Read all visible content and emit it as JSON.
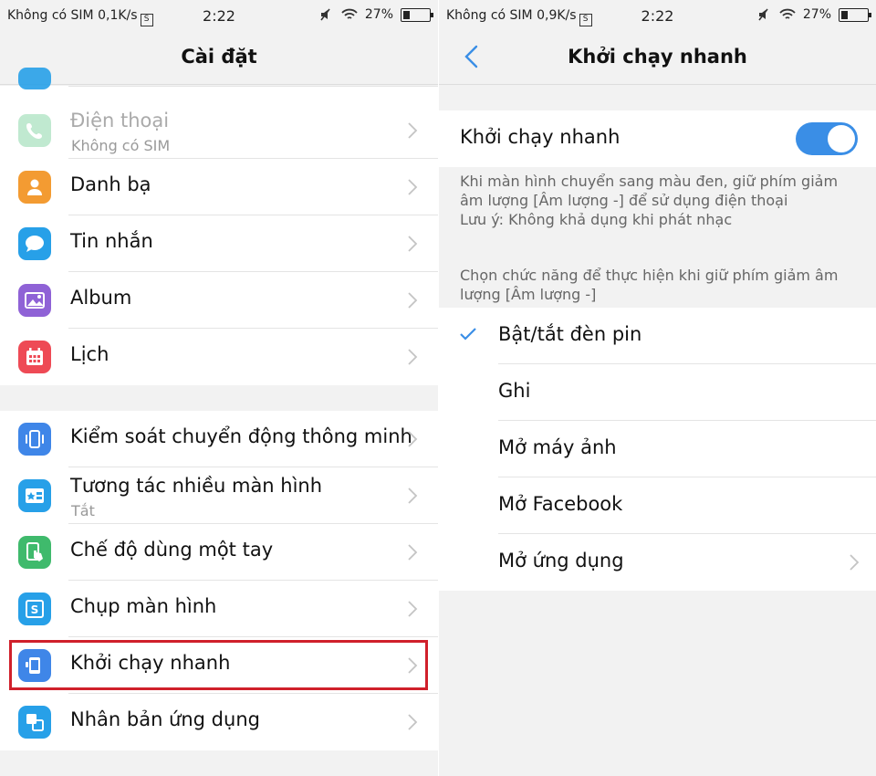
{
  "left": {
    "status": {
      "carrier": "Không có SIM",
      "speed": "0,1K/s",
      "sim_icon_text": "S",
      "time": "2:22",
      "battery": "27%",
      "battery_level": 0.27
    },
    "header": {
      "title": "Cài đặt"
    },
    "group1": [
      {
        "label": "Điện thoại",
        "sub": "Không có SIM",
        "icon": "phone-icon",
        "color": "#4cc37a",
        "disabled": true
      },
      {
        "label": "Danh bạ",
        "icon": "contact-icon",
        "color": "#f39b32"
      },
      {
        "label": "Tin nhắn",
        "icon": "message-icon",
        "color": "#27a0e8"
      },
      {
        "label": "Album",
        "icon": "album-icon",
        "color": "#8f62d6"
      },
      {
        "label": "Lịch",
        "icon": "calendar-icon",
        "color": "#ee4a55"
      }
    ],
    "group2": [
      {
        "label": "Kiểm soát chuyển động thông minh",
        "icon": "motion-control-icon",
        "color": "#3f86e8"
      },
      {
        "label": "Tương tác nhiều màn hình",
        "sub": "Tắt",
        "icon": "multi-screen-icon",
        "color": "#27a0e8"
      },
      {
        "label": "Chế độ dùng một tay",
        "icon": "one-hand-icon",
        "color": "#3fba6c"
      },
      {
        "label": "Chụp màn hình",
        "icon": "screenshot-icon",
        "color": "#27a0e8"
      },
      {
        "label": "Khởi chạy nhanh",
        "icon": "quick-launch-icon",
        "color": "#3f86e8",
        "highlighted": true
      },
      {
        "label": "Nhân bản ứng dụng",
        "icon": "app-clone-icon",
        "color": "#27a0e8"
      }
    ]
  },
  "right": {
    "status": {
      "carrier": "Không có SIM",
      "speed": "0,9K/s",
      "sim_icon_text": "S",
      "time": "2:22",
      "battery": "27%",
      "battery_level": 0.27
    },
    "header": {
      "title": "Khởi chạy nhanh"
    },
    "toggle": {
      "label": "Khởi chạy nhanh",
      "on": true,
      "accent": "#3a8ee6"
    },
    "note1_line1": "Khi màn hình chuyển sang màu đen, giữ phím giảm âm lượng [Âm lượng -] để sử dụng điện thoại",
    "note1_line2": "Lưu ý: Không khả dụng khi phát nhạc",
    "note2": "Chọn chức năng để thực hiện khi giữ phím giảm âm lượng [Âm lượng -]",
    "options": [
      {
        "label": "Bật/tắt đèn pin",
        "selected": true
      },
      {
        "label": "Ghi"
      },
      {
        "label": "Mở máy ảnh"
      },
      {
        "label": "Mở Facebook"
      },
      {
        "label": "Mở ứng dụng",
        "chevron": true
      }
    ]
  }
}
